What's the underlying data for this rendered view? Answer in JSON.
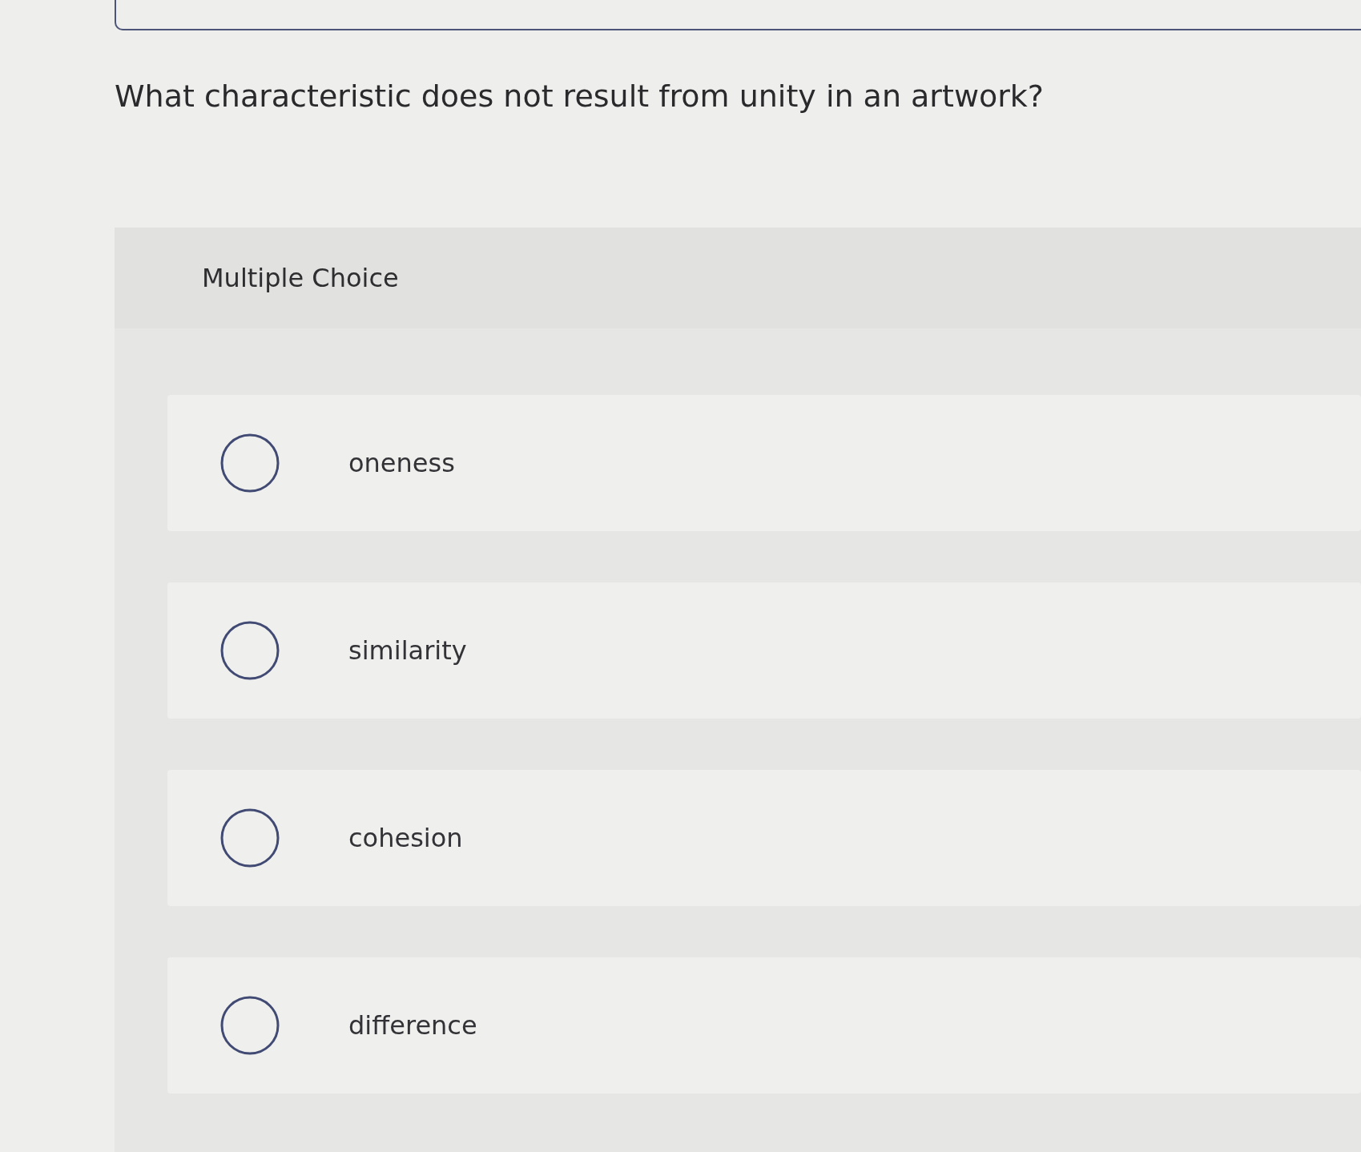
{
  "question": {
    "text": "What characteristic does not result from unity in an artwork?"
  },
  "choices": {
    "heading": "Multiple Choice",
    "options": [
      {
        "label": "oneness",
        "selected": false
      },
      {
        "label": "similarity",
        "selected": false
      },
      {
        "label": "cohesion",
        "selected": false
      },
      {
        "label": "difference",
        "selected": false
      }
    ]
  }
}
